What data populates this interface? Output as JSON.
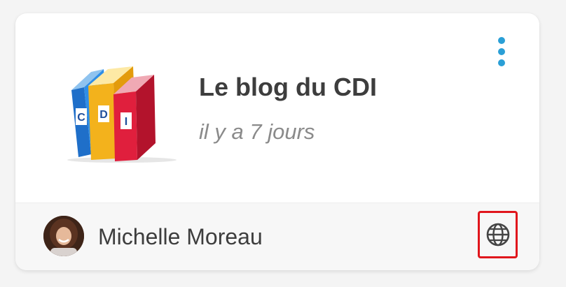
{
  "colors": {
    "accent": "#2a9fd6",
    "title": "#3d3d3d",
    "subtitle": "#8a8a8a",
    "highlight_border": "#e0161c"
  },
  "card": {
    "title": "Le blog du CDI",
    "timestamp": "il y a 7 jours",
    "thumbnail": {
      "icon": "cdi-books-image",
      "book_letters": [
        "C",
        "D",
        "I"
      ]
    },
    "menu_icon": "more-vertical-icon",
    "footer": {
      "author_name": "Michelle Moreau",
      "visibility_icon": "globe-icon"
    }
  }
}
